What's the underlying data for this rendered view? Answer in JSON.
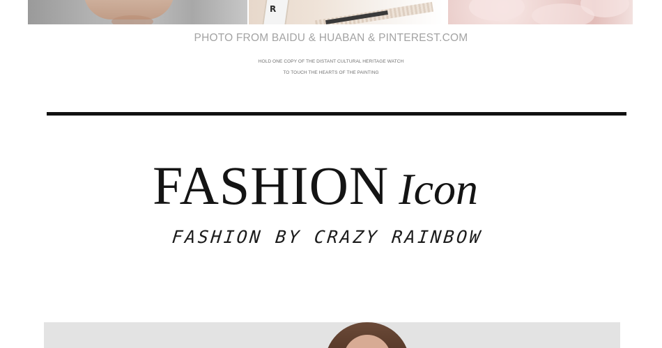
{
  "photos": {
    "top": [
      {
        "subject": "skin-tone close-up"
      },
      {
        "subject": "white strap with lettering",
        "strap_text": "R"
      },
      {
        "subject": "pink ruffled fabric"
      }
    ],
    "bottom": {
      "subject": "woman with brown hair"
    }
  },
  "credits": {
    "main": "PHOTO FROM BAIDU & HUABAN & PINTEREST.COM",
    "line1": "HOLD ONE COPY OF THE DISTANT CULTURAL HERITAGE WATCH",
    "line2": "TO TOUCH THE HEARTS OF THE PAINTING"
  },
  "heading": {
    "word": "FASHION",
    "script": "Icon"
  },
  "tagline": "FASHION BY CRAZY RAINBOW",
  "colors": {
    "background": "#ffffff",
    "divider": "#111111",
    "credit_text": "#a3a3a3",
    "heading_text": "#141414"
  }
}
